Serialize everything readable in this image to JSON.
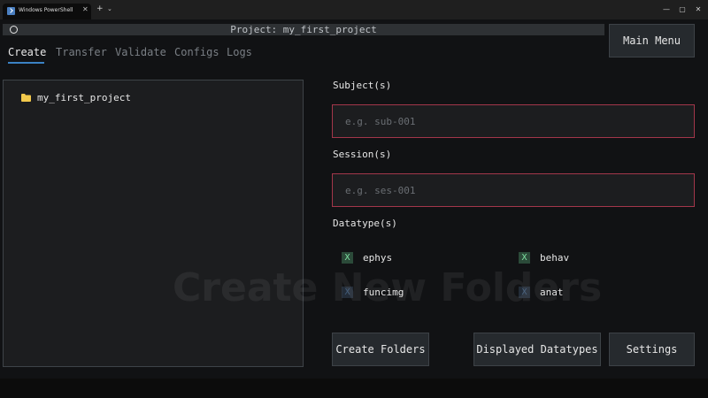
{
  "window": {
    "tab_title": "Windows PowerShell",
    "close_glyph": "✕",
    "new_tab_glyph": "+",
    "dropdown_glyph": "⌄",
    "minimize_glyph": "—",
    "maximize_glyph": "▢",
    "window_close_glyph": "✕"
  },
  "header": {
    "title": "Project: my_first_project"
  },
  "nav": {
    "tabs": [
      "Create",
      "Transfer",
      "Validate",
      "Configs",
      "Logs"
    ],
    "active": "Create"
  },
  "main_menu_label": "Main Menu",
  "tree": {
    "root": "my_first_project",
    "icon": "folder-icon"
  },
  "subjects": {
    "label": "Subject(s)",
    "placeholder": "e.g. sub-001",
    "value": ""
  },
  "sessions": {
    "label": "Session(s)",
    "placeholder": "e.g. ses-001",
    "value": ""
  },
  "datatypes": {
    "label": "Datatype(s)",
    "items": [
      {
        "name": "ephys",
        "checked": true,
        "mark": "X"
      },
      {
        "name": "behav",
        "checked": true,
        "mark": "X"
      },
      {
        "name": "funcimg",
        "checked": false,
        "mark": "X"
      },
      {
        "name": "anat",
        "checked": false,
        "mark": "X"
      }
    ]
  },
  "watermark": "Create New Folders",
  "buttons": {
    "create": "Create Folders",
    "displayed": "Displayed Datatypes",
    "settings": "Settings"
  },
  "colors": {
    "accent": "#3b82c4",
    "input_border": "#a3364a",
    "checked_bg": "#2b4a39",
    "folder": "#f2c94c"
  }
}
